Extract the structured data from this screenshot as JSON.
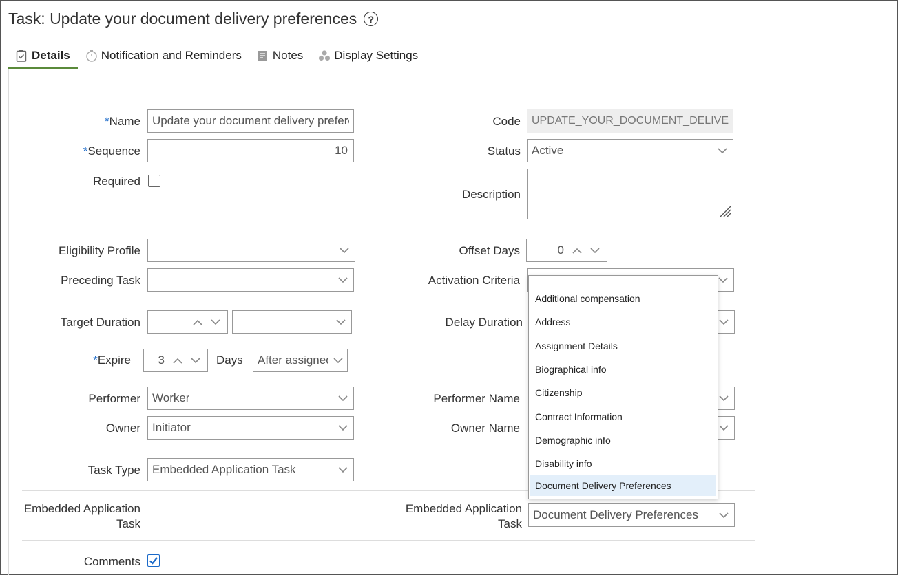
{
  "page": {
    "title": "Task: Update your document delivery preferences"
  },
  "tabs": [
    {
      "label": "Details",
      "icon": "clipboard-icon",
      "active": true
    },
    {
      "label": "Notification and Reminders",
      "icon": "stopwatch-icon"
    },
    {
      "label": "Notes",
      "icon": "notes-icon"
    },
    {
      "label": "Display Settings",
      "icon": "display-settings-icon"
    }
  ],
  "form": {
    "name": {
      "label": "Name",
      "value": "Update your document delivery prefere"
    },
    "sequence": {
      "label": "Sequence",
      "value": "10"
    },
    "required": {
      "label": "Required",
      "checked": false
    },
    "code": {
      "label": "Code",
      "value": "UPDATE_YOUR_DOCUMENT_DELIVERY"
    },
    "status": {
      "label": "Status",
      "value": "Active"
    },
    "description": {
      "label": "Description",
      "value": ""
    },
    "eligibility_profile": {
      "label": "Eligibility Profile",
      "value": ""
    },
    "offset_days": {
      "label": "Offset Days",
      "value": "0"
    },
    "preceding_task": {
      "label": "Preceding Task",
      "value": ""
    },
    "activation_criteria": {
      "label": "Activation Criteria",
      "value": ""
    },
    "target_duration": {
      "label": "Target Duration",
      "value": "",
      "unit": ""
    },
    "delay_duration": {
      "label": "Delay Duration"
    },
    "expire": {
      "label": "Expire",
      "value": "3",
      "days_label": "Days",
      "when": "After assigned"
    },
    "performer": {
      "label": "Performer",
      "value": "Worker"
    },
    "performer_name": {
      "label": "Performer Name"
    },
    "owner": {
      "label": "Owner",
      "value": "Initiator"
    },
    "owner_name": {
      "label": "Owner Name"
    },
    "task_type": {
      "label": "Task Type",
      "value": "Embedded Application Task"
    },
    "embedded_left": {
      "label_line1": "Embedded Application",
      "label_line2": "Task"
    },
    "embedded_right": {
      "label_line1": "Embedded Application",
      "label_line2": "Task",
      "value": "Document Delivery Preferences"
    },
    "comments": {
      "label": "Comments",
      "checked": true
    }
  },
  "activation_dropdown": {
    "items": [
      "Additional compensation",
      "Address",
      "Assignment Details",
      "Biographical info",
      "Citizenship",
      "Contract Information",
      "Demographic info",
      "Disability info",
      "Document Delivery Preferences"
    ],
    "selected_index": 8
  },
  "colors": {
    "required_star": "#1b6ac9",
    "active_tab_underline": "#5a8a3a",
    "selected_item_bg": "#e3effa"
  }
}
